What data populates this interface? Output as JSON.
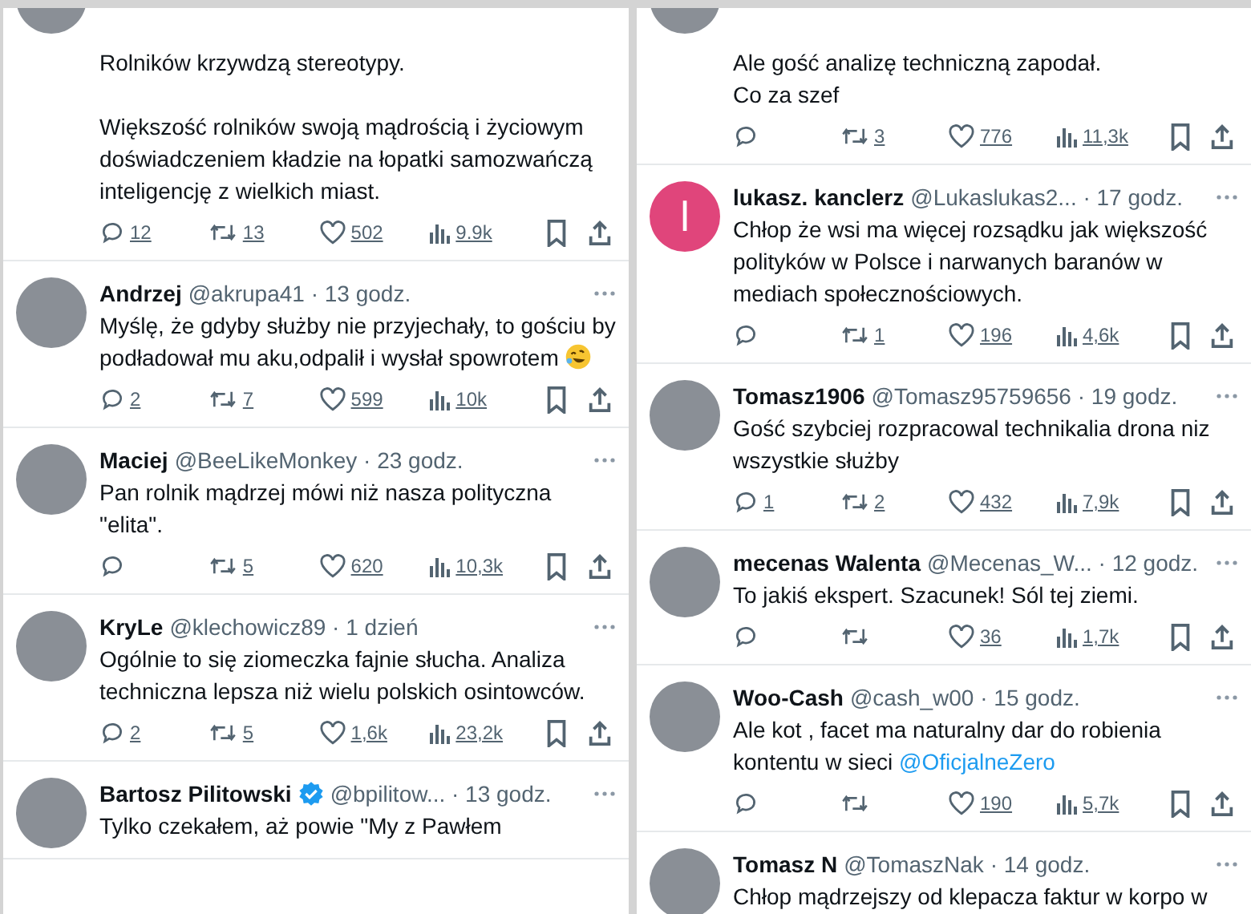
{
  "columns": [
    {
      "tweets": [
        {
          "cut_top": true,
          "body": [
            "Rolników krzywdzą stereotypy.",
            "Większość rolników swoją mądrością i życiowym doświadczeniem kładzie na łopatki samozwańczą inteligencję z wielkich miast."
          ],
          "stats": {
            "replies": "12",
            "reposts": "13",
            "likes": "502",
            "views": "9.9k"
          }
        },
        {
          "name": "Andrzej",
          "meta": "@akrupa41 · 13 godz.",
          "body": [
            "Myślę, że gdyby służby nie przyjechały, to gościu by  podładował mu aku,odpalił i wysłał spowrotem"
          ],
          "has_emoji": true,
          "stats": {
            "replies": "2",
            "reposts": "7",
            "likes": "599",
            "views": "10k"
          }
        },
        {
          "name": "Maciej",
          "meta": "@BeeLikeMonkey · 23 godz.",
          "body": [
            "Pan rolnik mądrzej mówi niż nasza polityczna \"elita\"."
          ],
          "stats": {
            "reposts": "5",
            "likes": "620",
            "views": "10,3k"
          }
        },
        {
          "name": "KryLe",
          "meta": "@klechowicz89 · 1 dzień",
          "body": [
            "Ogólnie to się ziomeczka fajnie słucha. Analiza techniczna lepsza niż wielu polskich osintowców."
          ],
          "stats": {
            "replies": "2",
            "reposts": "5",
            "likes": "1,6k",
            "views": "23,2k"
          }
        },
        {
          "name": "Bartosz Pilitowski",
          "verified": true,
          "meta": "@bpilitow... · 13 godz.",
          "body": [
            "Tylko czekałem, aż powie \"My z Pawłem"
          ]
        }
      ]
    },
    {
      "tweets": [
        {
          "cut_top": true,
          "body": [
            "Ale gość analizę techniczną zapodał.\nCo za szef"
          ],
          "stats": {
            "reposts": "3",
            "likes": "776",
            "views": "11,3k"
          }
        },
        {
          "avatar_letter": "l",
          "name": "lukasz. kanclerz",
          "meta": "@Lukaslukas2... · 17 godz.",
          "body": [
            "Chłop że wsi ma więcej rozsądku jak większość polityków w Polsce i narwanych baranów w mediach społecznościowych."
          ],
          "stats": {
            "reposts": "1",
            "likes": "196",
            "views": "4,6k"
          }
        },
        {
          "name": "Tomasz1906",
          "meta": "@Tomasz95759656 · 19 godz.",
          "body": [
            "Gość szybciej rozpracowal technikalia drona niz wszystkie służby"
          ],
          "stats": {
            "replies": "1",
            "reposts": "2",
            "likes": "432",
            "views": "7,9k"
          }
        },
        {
          "name": "mecenas Walenta",
          "meta": "@Mecenas_W... · 12 godz.",
          "body": [
            "To jakiś ekspert. Szacunek! Sól tej ziemi."
          ],
          "stats": {
            "likes": "36",
            "views": "1,7k"
          }
        },
        {
          "name": "Woo-Cash",
          "meta": "@cash_w00 · 15 godz.",
          "body": [
            "Ale kot , facet ma naturalny dar do robienia kontentu w sieci"
          ],
          "mention": "@OficjalneZero",
          "stats": {
            "likes": "190",
            "views": "5,7k"
          }
        },
        {
          "name": "Tomasz N",
          "meta": "@TomaszNak · 14 godz.",
          "body": [
            "Chłop mądrzejszy od klepacza faktur w korpo w"
          ]
        }
      ]
    }
  ]
}
